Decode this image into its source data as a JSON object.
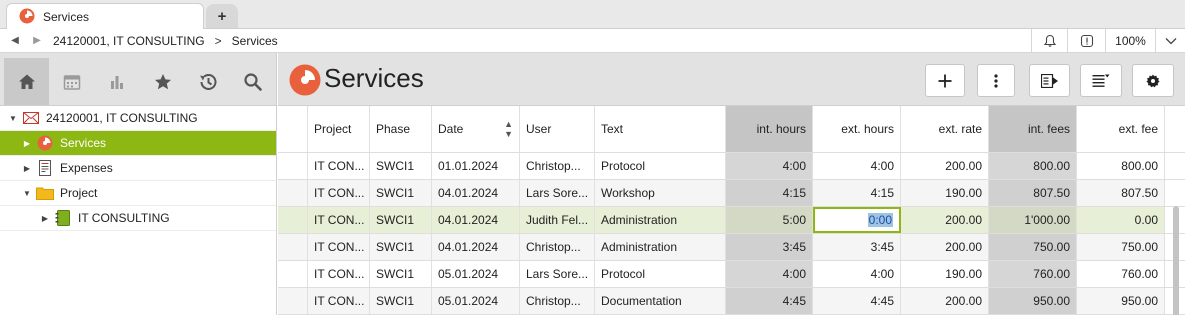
{
  "tab": {
    "title": "Services",
    "new_tab_label": "+"
  },
  "nav": {
    "back_icon": "arrow-left-icon",
    "forward_icon": "arrow-right-icon",
    "breadcrumb": [
      "24120001, IT CONSULTING",
      "Services"
    ],
    "separator": ">",
    "zoom": "100%"
  },
  "sidebar": {
    "toolbar": [
      "home-icon",
      "calendar-icon",
      "chart-icon",
      "star-icon",
      "history-icon",
      "search-icon"
    ],
    "tree": [
      {
        "label": "24120001, IT CONSULTING",
        "icon": "envelope-icon",
        "expanded": true,
        "level": 0
      },
      {
        "label": "Services",
        "icon": "services-icon",
        "expanded": false,
        "level": 1,
        "selected": true
      },
      {
        "label": "Expenses",
        "icon": "receipt-icon",
        "expanded": false,
        "level": 1
      },
      {
        "label": "Project",
        "icon": "folder-icon",
        "expanded": true,
        "level": 1
      },
      {
        "label": "IT CONSULTING",
        "icon": "notebook-icon",
        "expanded": false,
        "level": 2
      }
    ]
  },
  "main": {
    "title": "Services",
    "toolbar": [
      "add-icon",
      "more-icon",
      "export-icon",
      "list-filter-icon",
      "settings-icon"
    ],
    "colors": {
      "accent": "#8db814",
      "shade": "#c5c5c5",
      "highlight": "#e7efd6"
    },
    "columns": [
      "Project",
      "Phase",
      "Date",
      "User",
      "Text",
      "int. hours",
      "ext. hours",
      "ext. rate",
      "int. fees",
      "ext. fee"
    ],
    "rows": [
      [
        "IT CON...",
        "SWCI1",
        "01.01.2024",
        "Christop...",
        "Protocol",
        "4:00",
        "4:00",
        "200.00",
        "800.00",
        "800.00"
      ],
      [
        "IT CON...",
        "SWCI1",
        "04.01.2024",
        "Lars Sore...",
        "Workshop",
        "4:15",
        "4:15",
        "190.00",
        "807.50",
        "807.50"
      ],
      [
        "IT CON...",
        "SWCI1",
        "04.01.2024",
        "Judith Fel...",
        "Administration",
        "5:00",
        "0:00",
        "200.00",
        "1'000.00",
        "0.00"
      ],
      [
        "IT CON...",
        "SWCI1",
        "04.01.2024",
        "Christop...",
        "Administration",
        "3:45",
        "3:45",
        "200.00",
        "750.00",
        "750.00"
      ],
      [
        "IT CON...",
        "SWCI1",
        "05.01.2024",
        "Lars Sore...",
        "Protocol",
        "4:00",
        "4:00",
        "190.00",
        "760.00",
        "760.00"
      ],
      [
        "IT CON...",
        "SWCI1",
        "05.01.2024",
        "Christop...",
        "Documentation",
        "4:45",
        "4:45",
        "200.00",
        "950.00",
        "950.00"
      ]
    ]
  }
}
